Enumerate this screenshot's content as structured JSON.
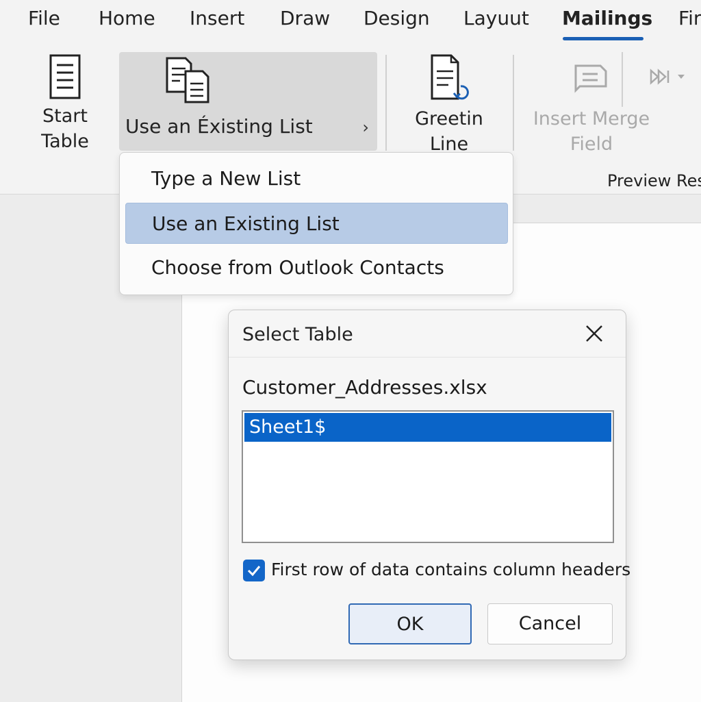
{
  "tabs": [
    {
      "label": "File",
      "active": false
    },
    {
      "label": "Home",
      "active": false
    },
    {
      "label": "Insert",
      "active": false
    },
    {
      "label": "Draw",
      "active": false
    },
    {
      "label": "Design",
      "active": false
    },
    {
      "label": "Layuut",
      "active": false
    },
    {
      "label": "Mailings",
      "active": true
    },
    {
      "label": "Fir",
      "active": false
    }
  ],
  "ribbon": {
    "start_table": {
      "line1": "Start",
      "line2": "Table",
      "icon": "document-icon"
    },
    "select_recipients": {
      "label": "Use an Éxisting List",
      "chevron": "›",
      "icon": "document-stack-icon"
    },
    "greeting_line": {
      "line1": "Greetin",
      "line2": "Line",
      "icon": "document-arrow-icon"
    },
    "insert_merge_field": {
      "line1": "Insert Merge",
      "line2": "Field",
      "icon": "merge-field-icon",
      "disabled": true
    },
    "preview_results": {
      "icon": "preview-results-icon",
      "dropdown": "chevron-down-icon"
    },
    "group_label": "Preview Res"
  },
  "menu": {
    "items": [
      {
        "label": "Type a New List",
        "selected": false
      },
      {
        "label": "Use an Existing List",
        "selected": true
      },
      {
        "label": "Choose from Outlook Contacts",
        "selected": false
      }
    ]
  },
  "dialog": {
    "title": "Select Table",
    "file_name": "Customer_Addresses.xlsx",
    "tables": [
      {
        "name": "Sheet1$",
        "selected": true
      }
    ],
    "checkbox": {
      "label": "First row of data contains column headers",
      "checked": true
    },
    "ok_label": "OK",
    "cancel_label": "Cancel"
  },
  "colors": {
    "accent": "#1a5fb4",
    "selection": "#0a64c8",
    "menu_highlight": "#b7cbe6"
  }
}
